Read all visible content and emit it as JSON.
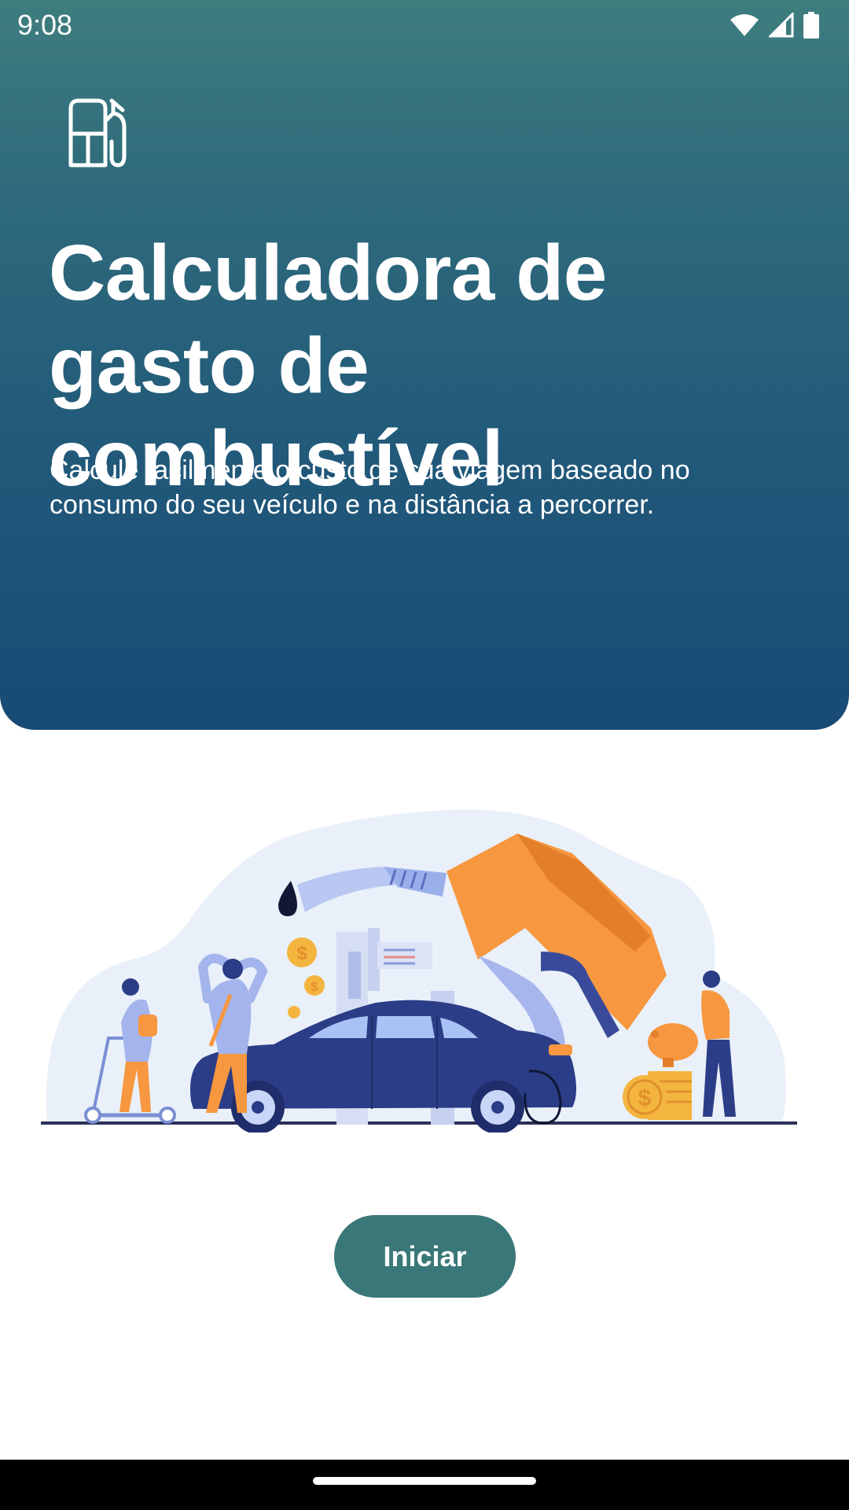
{
  "status_bar": {
    "time": "9:08",
    "icons": [
      "wifi-icon",
      "signal-icon",
      "battery-icon"
    ]
  },
  "hero": {
    "icon": "fuel-pump-icon",
    "title": "Calculadora de gasto de combustível",
    "subtitle": "Calcule facilmente o custo de sua viagem baseado no consumo do seu veículo e na distância a percorrer.",
    "gradient_colors": [
      "#3e7d7e",
      "#174a75"
    ]
  },
  "illustration": {
    "name": "fuel-cost-illustration",
    "coin_symbol": "$"
  },
  "actions": {
    "start_label": "Iniciar",
    "start_color": "#3a7778"
  },
  "nav": {
    "home_indicator": "home-indicator"
  }
}
